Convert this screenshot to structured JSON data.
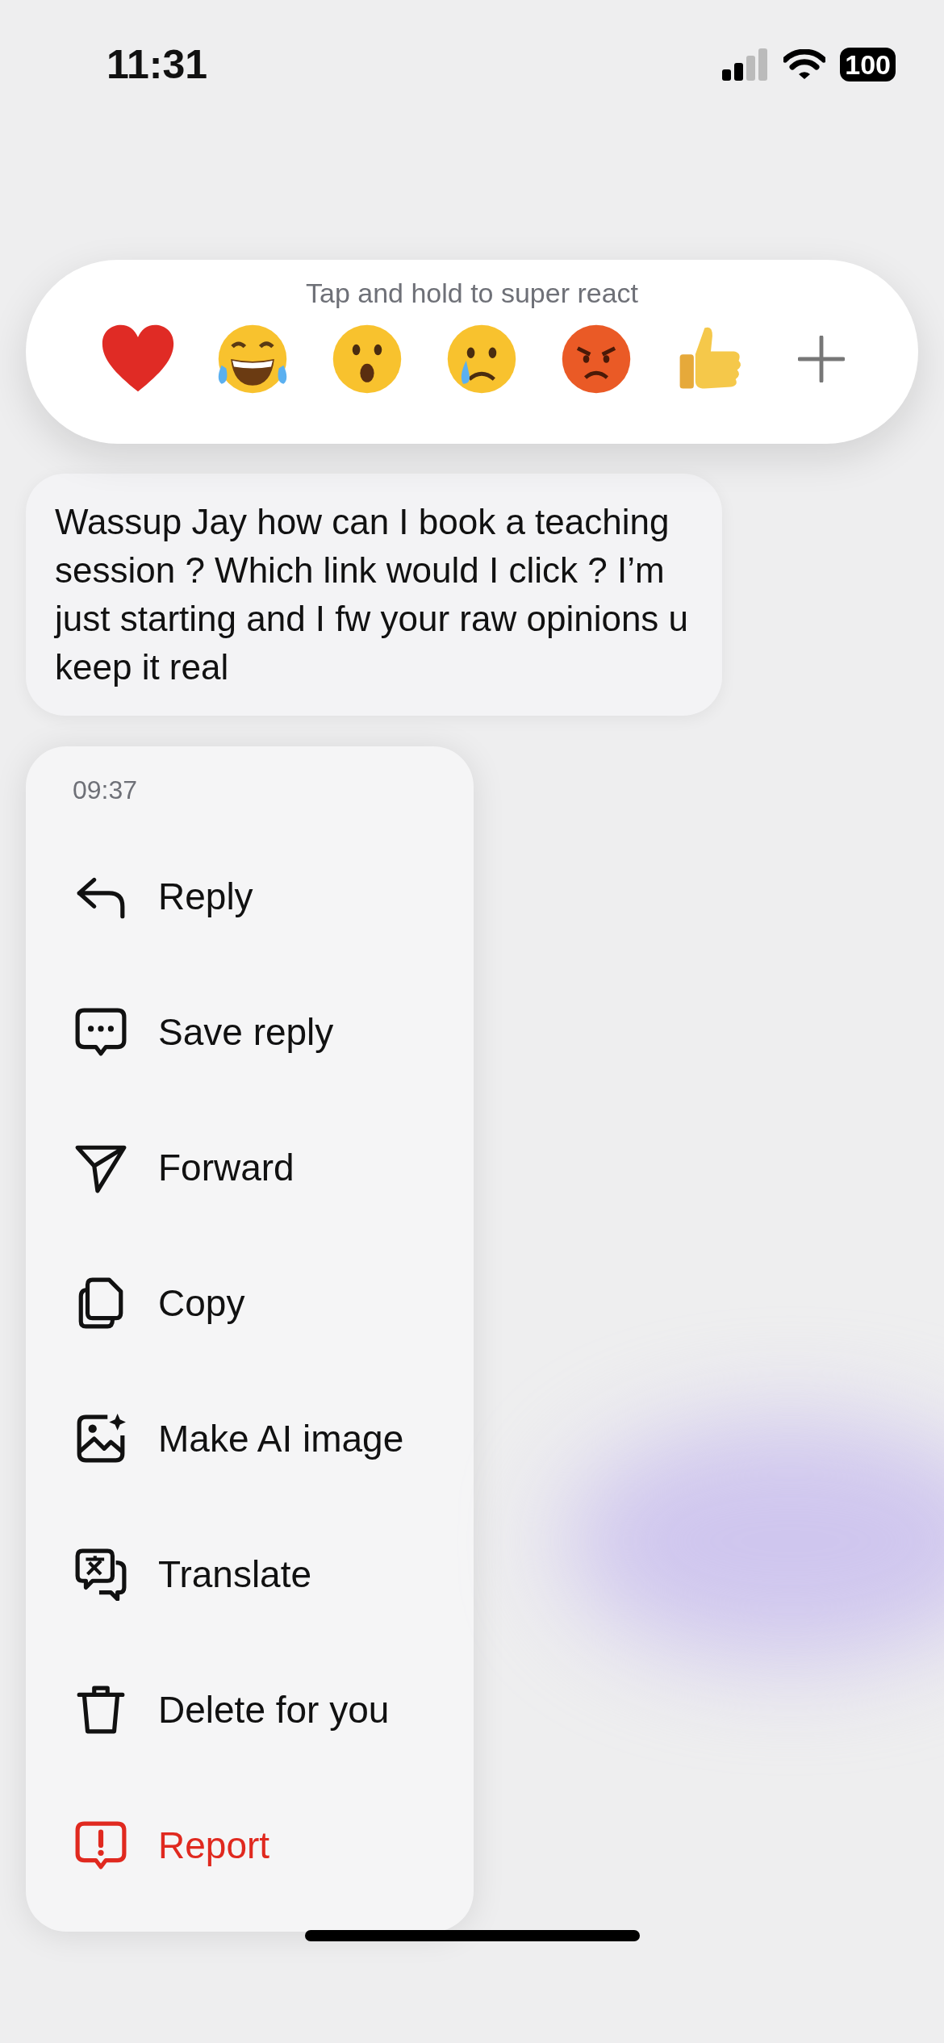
{
  "status_bar": {
    "time": "11:31",
    "battery": "100"
  },
  "reaction_bar": {
    "hint": "Tap and hold to super react"
  },
  "message": {
    "text": "Wassup Jay how can I book a teaching session ? Which link would I click ? I’m just starting and I fw your raw opinions u keep it real"
  },
  "menu": {
    "time": "09:37",
    "items": [
      {
        "label": "Reply",
        "kind": "normal"
      },
      {
        "label": "Save reply",
        "kind": "normal"
      },
      {
        "label": "Forward",
        "kind": "normal"
      },
      {
        "label": "Copy",
        "kind": "normal"
      },
      {
        "label": "Make AI image",
        "kind": "normal"
      },
      {
        "label": "Translate",
        "kind": "normal"
      },
      {
        "label": "Delete for you",
        "kind": "normal"
      },
      {
        "label": "Report",
        "kind": "destructive"
      }
    ]
  }
}
